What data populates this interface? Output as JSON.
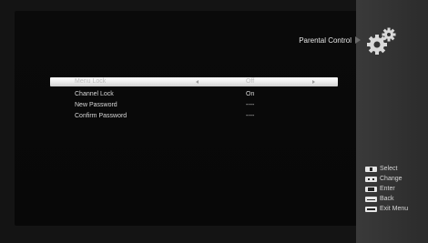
{
  "header": {
    "title": "Parental Control"
  },
  "menu": {
    "items": [
      {
        "label": "Menu Lock",
        "value": "Off",
        "selected": true
      },
      {
        "label": "Channel Lock",
        "value": "On",
        "selected": false
      },
      {
        "label": "New Password",
        "value": "----",
        "selected": false
      },
      {
        "label": "Confirm Password",
        "value": "----",
        "selected": false
      }
    ]
  },
  "help": [
    {
      "key_icon": "select-key-icon",
      "label": "Select"
    },
    {
      "key_icon": "change-key-icon",
      "label": "Change"
    },
    {
      "key_icon": "ok-key-icon",
      "label": "Enter"
    },
    {
      "key_icon": "back-key-icon",
      "label": "Back"
    },
    {
      "key_icon": "exit-key-icon",
      "label": "Exit Menu"
    }
  ],
  "colors": {
    "highlight": "#f2f2f2",
    "text": "#d8d8d8",
    "background": "#0a0a0a"
  }
}
